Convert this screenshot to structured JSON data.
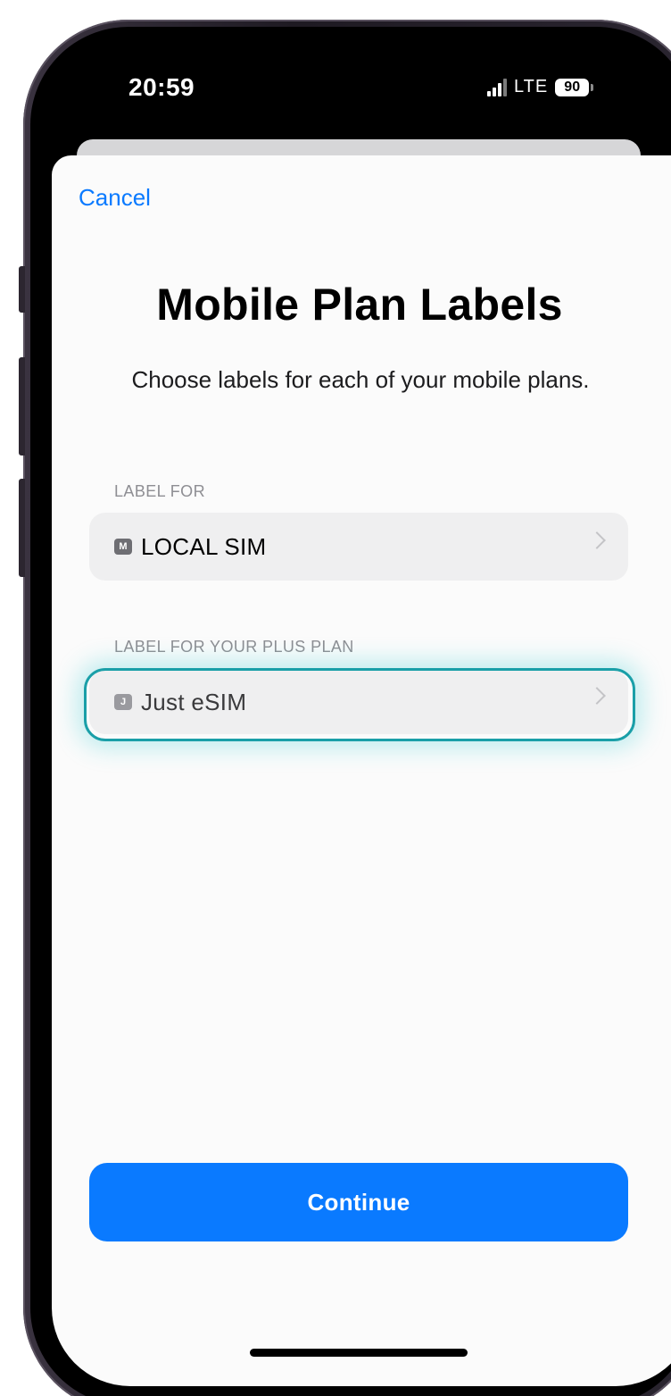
{
  "status_bar": {
    "time": "20:59",
    "network": "LTE",
    "battery": "90"
  },
  "sheet": {
    "cancel_label": "Cancel",
    "title": "Mobile Plan Labels",
    "subtitle": "Choose labels for each of your mobile plans."
  },
  "plans": [
    {
      "section_label": "LABEL FOR",
      "badge": "M",
      "label": "LOCAL SIM"
    },
    {
      "section_label": "LABEL FOR YOUR PLUS PLAN",
      "badge": "J",
      "label": "Just eSIM"
    }
  ],
  "continue_label": "Continue",
  "colors": {
    "accent": "#0a7aff",
    "highlight": "#1a9fa8"
  },
  "icons": {
    "signal": "cellular-signal-icon",
    "battery": "battery-icon",
    "chevron": "chevron-right-icon"
  }
}
